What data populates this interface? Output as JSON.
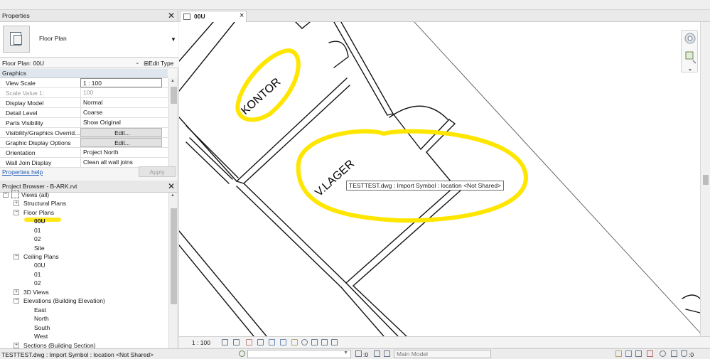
{
  "properties": {
    "title": "Properties",
    "type_name": "Floor Plan",
    "instance_label": "Floor Plan: 00U",
    "edit_type": "Edit Type",
    "group": "Graphics",
    "rows": [
      {
        "key": "View Scale",
        "value": "1 : 100"
      },
      {
        "key": "Scale Value    1:",
        "value": "100"
      },
      {
        "key": "Display Model",
        "value": "Normal"
      },
      {
        "key": "Detail Level",
        "value": "Coarse"
      },
      {
        "key": "Parts Visibility",
        "value": "Show Original"
      },
      {
        "key": "Visibility/Graphics Overrid...",
        "value": "Edit..."
      },
      {
        "key": "Graphic Display Options",
        "value": "Edit..."
      },
      {
        "key": "Orientation",
        "value": "Project North"
      },
      {
        "key": "Wall Join Display",
        "value": "Clean all wall joins"
      }
    ],
    "help_link": "Properties help",
    "apply": "Apply"
  },
  "browser": {
    "title": "Project Browser - B-ARK.rvt",
    "views_all": "Views (all)",
    "structural_plans": "Structural Plans",
    "floor_plans": "Floor Plans",
    "floor_items": [
      "00U",
      "01",
      "02",
      "Site"
    ],
    "ceiling_plans": "Ceiling Plans",
    "ceiling_items": [
      "00U",
      "01",
      "02"
    ],
    "views_3d": "3D Views",
    "elevations": "Elevations (Building Elevation)",
    "elevation_items": [
      "East",
      "North",
      "South",
      "West"
    ],
    "sections": "Sections (Building Section)"
  },
  "view": {
    "tab_label": "00U",
    "room_labels": [
      "KONTOR",
      "V.LAGER"
    ],
    "tooltip": "TESTTEST.dwg : Import Symbol : location <Not Shared>",
    "scale": "1 : 100"
  },
  "status": {
    "text": "TESTTEST.dwg : Import Symbol : location <Not Shared>",
    "count1": ":0",
    "model": "Main Model",
    "count2": ":0"
  },
  "colors": {
    "highlight": "#ffe600",
    "link": "#1c5bb8"
  }
}
